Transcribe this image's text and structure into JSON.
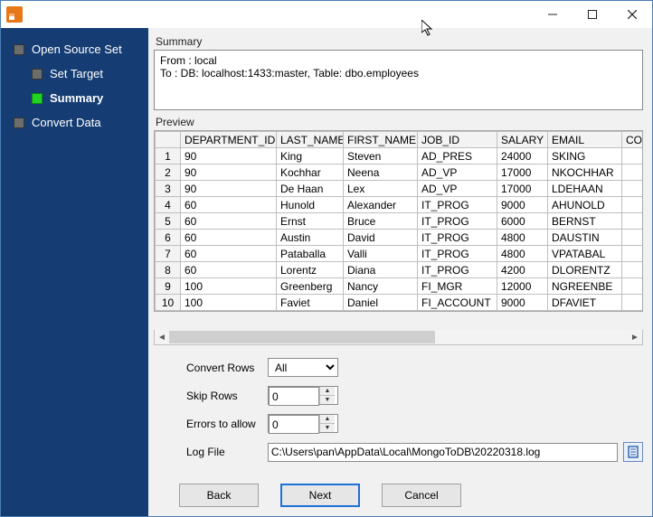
{
  "window": {
    "title": ""
  },
  "sidebar": {
    "items": [
      {
        "label": "Open Source Set",
        "indent": 0,
        "current": false
      },
      {
        "label": "Set Target",
        "indent": 1,
        "current": false
      },
      {
        "label": "Summary",
        "indent": 1,
        "current": true
      },
      {
        "label": "Convert Data",
        "indent": 0,
        "current": false
      }
    ]
  },
  "summary": {
    "label": "Summary",
    "text": "From : local\nTo : DB: localhost:1433:master, Table: dbo.employees"
  },
  "preview": {
    "label": "Preview",
    "columns": [
      "DEPARTMENT_ID",
      "LAST_NAME",
      "FIRST_NAME",
      "JOB_ID",
      "SALARY",
      "EMAIL",
      "COMMIS"
    ],
    "rows": [
      [
        "90",
        "King",
        "Steven",
        "AD_PRES",
        "24000",
        "SKING",
        ""
      ],
      [
        "90",
        "Kochhar",
        "Neena",
        "AD_VP",
        "17000",
        "NKOCHHAR",
        ""
      ],
      [
        "90",
        "De Haan",
        "Lex",
        "AD_VP",
        "17000",
        "LDEHAAN",
        ""
      ],
      [
        "60",
        "Hunold",
        "Alexander",
        "IT_PROG",
        "9000",
        "AHUNOLD",
        ""
      ],
      [
        "60",
        "Ernst",
        "Bruce",
        "IT_PROG",
        "6000",
        "BERNST",
        ""
      ],
      [
        "60",
        "Austin",
        "David",
        "IT_PROG",
        "4800",
        "DAUSTIN",
        ""
      ],
      [
        "60",
        "Pataballa",
        "Valli",
        "IT_PROG",
        "4800",
        "VPATABAL",
        ""
      ],
      [
        "60",
        "Lorentz",
        "Diana",
        "IT_PROG",
        "4200",
        "DLORENTZ",
        ""
      ],
      [
        "100",
        "Greenberg",
        "Nancy",
        "FI_MGR",
        "12000",
        "NGREENBE",
        ""
      ],
      [
        "100",
        "Faviet",
        "Daniel",
        "FI_ACCOUNT",
        "9000",
        "DFAVIET",
        ""
      ]
    ]
  },
  "form": {
    "convert_rows": {
      "label": "Convert Rows",
      "value": "All"
    },
    "skip_rows": {
      "label": "Skip Rows",
      "value": "0"
    },
    "errors": {
      "label": "Errors to allow",
      "value": "0"
    },
    "log_file": {
      "label": "Log File",
      "value": "C:\\Users\\pan\\AppData\\Local\\MongoToDB\\20220318.log"
    }
  },
  "buttons": {
    "back": "Back",
    "next": "Next",
    "cancel": "Cancel"
  }
}
